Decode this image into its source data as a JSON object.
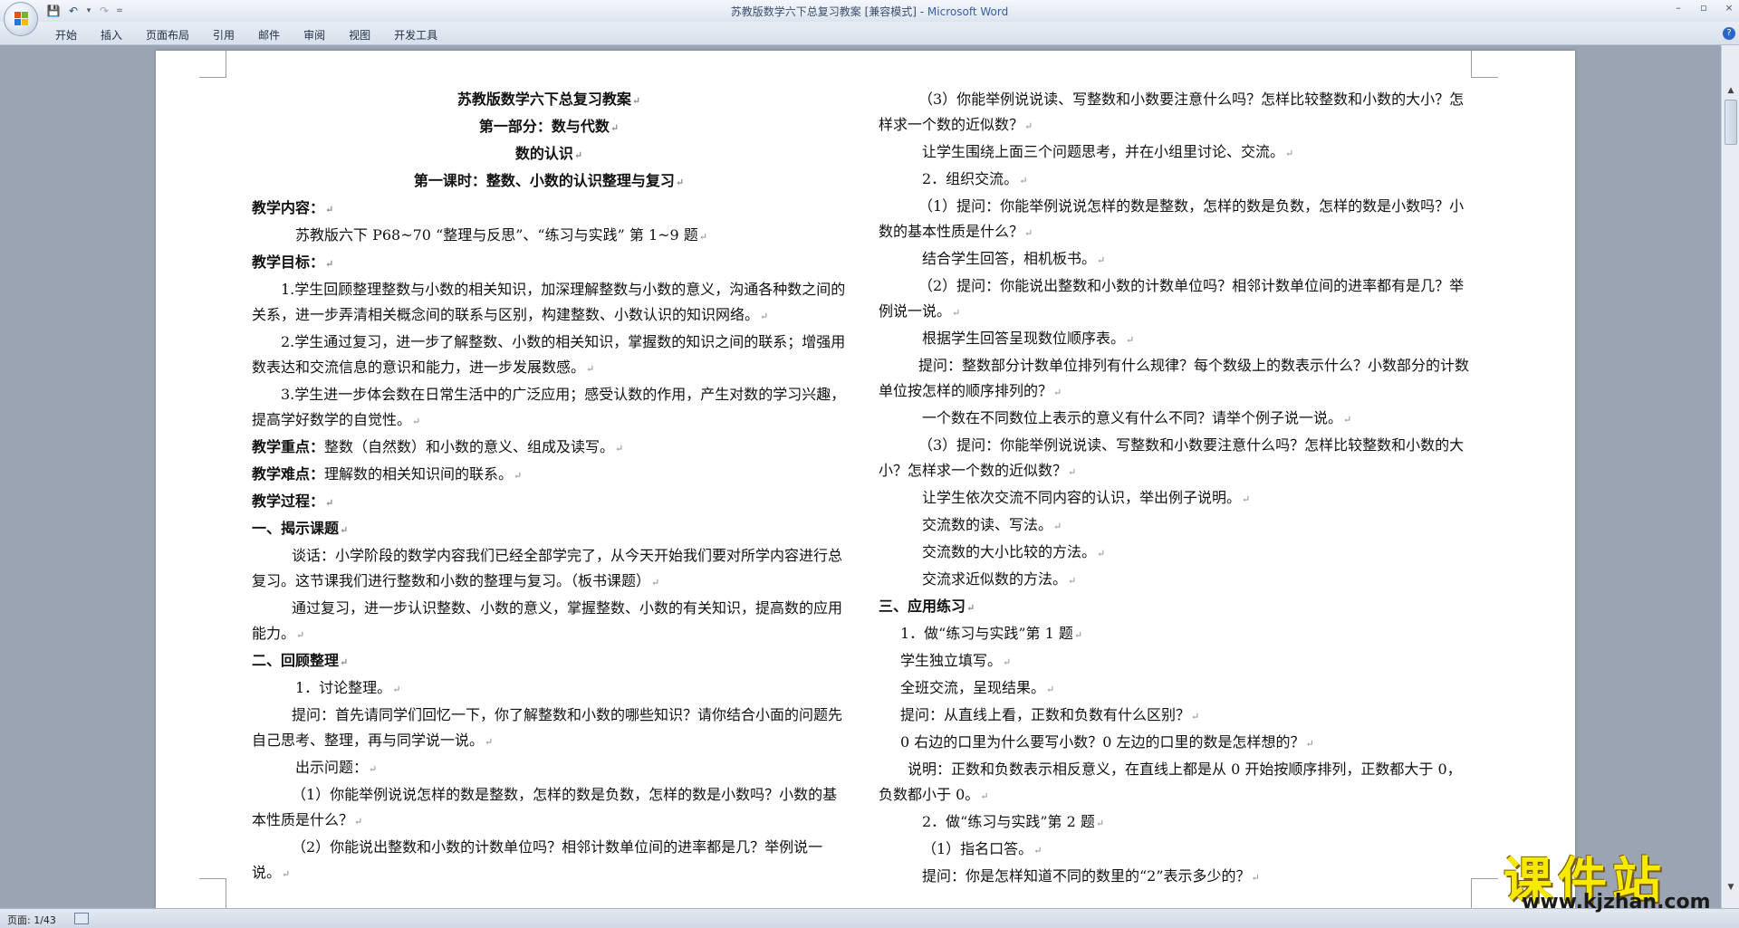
{
  "window": {
    "title": "苏教版数学六下总复习教案 [兼容模式] - ",
    "app_name": "Microsoft Word",
    "controls": [
      "–",
      "▫",
      "×"
    ]
  },
  "qat": {
    "save_icon": "💾",
    "undo_icon": "↶",
    "redo_icon": "↷",
    "dropdown": "▾",
    "customize": "="
  },
  "ribbon": {
    "tabs": [
      "开始",
      "插入",
      "页面布局",
      "引用",
      "邮件",
      "审阅",
      "视图",
      "开发工具"
    ],
    "help_icon": "?"
  },
  "document": {
    "left": [
      {
        "text": "苏教版数学六下总复习教案",
        "style": "center b"
      },
      {
        "text": "第一部分：数与代数",
        "style": "center b"
      },
      {
        "text": "数的认识",
        "style": "center b"
      },
      {
        "text": "第一课时：整数、小数的认识整理与复习",
        "style": "center b"
      },
      {
        "text": "教学内容：",
        "style": "b"
      },
      {
        "text": "苏教版六下 P68~70 “整理与反思”、“练习与实践” 第 1~9 题",
        "style": "ind3"
      },
      {
        "text": "教学目标：",
        "style": "b"
      },
      {
        "text": "1.学生回顾整理整数与小数的相关知识，加深理解整数与小数的意义，沟通各种数之间的关系，进一步弄清相关概念间的联系与区别，构建整数、小数认识的知识网络。",
        "style": "i1"
      },
      {
        "text": "2.学生通过复习，进一步了解整数、小数的相关知识，掌握数的知识之间的联系；增强用数表达和交流信息的意识和能力，进一步发展数感。",
        "style": "i1"
      },
      {
        "text": "3.学生进一步体会数在日常生活中的广泛应用；感受认数的作用，产生对数的学习兴趣，提高学好数学的自觉性。",
        "style": "i1"
      },
      {
        "text": "教学重点：整数（自然数）和小数的意义、组成及读写。",
        "style": "b-lead",
        "lead": "教学重点：",
        "rest": "整数（自然数）和小数的意义、组成及读写。"
      },
      {
        "text": "教学难点：理解数的相关知识间的联系。",
        "style": "b-lead",
        "lead": "教学难点：",
        "rest": "理解数的相关知识间的联系。"
      },
      {
        "text": "教学过程：",
        "style": "b"
      },
      {
        "text": "一、揭示课题",
        "style": "b"
      },
      {
        "text": "谈话：小学阶段的数学内容我们已经全部学完了，从今天开始我们要对所学内容进行总复习。这节课我们进行整数和小数的整理与复习。（板书课题）",
        "style": "i2"
      },
      {
        "text": "通过复习，进一步认识整数、小数的意义，掌握整数、小数的有关知识，提高数的应用能力。",
        "style": "i2"
      },
      {
        "text": "二、回顾整理",
        "style": "b"
      },
      {
        "text": "1．讨论整理。",
        "style": "ind3"
      },
      {
        "text": "提问：首先请同学们回忆一下，你了解整数和小数的哪些知识？请你结合小面的问题先自己思考、整理，再与同学说一说。",
        "style": "i2"
      },
      {
        "text": "出示问题：",
        "style": "ind3"
      },
      {
        "text": "（1）你能举例说说怎样的数是整数，怎样的数是负数，怎样的数是小数吗？小数的基本性质是什么？",
        "style": "i2"
      },
      {
        "text": "（2）你能说出整数和小数的计数单位吗？相邻计数单位间的进率都是几？举例说一说。",
        "style": "i2"
      }
    ],
    "right": [
      {
        "text": "（3）你能举例说说读、写整数和小数要注意什么吗？怎样比较整数和小数的大小？怎样求一个数的近似数？",
        "style": "i2"
      },
      {
        "text": "让学生围绕上面三个问题思考，并在小组里讨论、交流。",
        "style": "ind3"
      },
      {
        "text": "2．组织交流。",
        "style": "ind3"
      },
      {
        "text": "（1）提问：你能举例说说怎样的数是整数，怎样的数是负数，怎样的数是小数吗？小数的基本性质是什么？",
        "style": "i2"
      },
      {
        "text": "结合学生回答，相机板书。",
        "style": "ind3"
      },
      {
        "text": "（2）提问：你能说出整数和小数的计数单位吗？相邻计数单位间的进率都有是几？举例说一说。",
        "style": "i2"
      },
      {
        "text": "根据学生回答呈现数位顺序表。",
        "style": "ind3"
      },
      {
        "text": "提问：整数部分计数单位排列有什么规律？每个数级上的数表示什么？小数部分的计数单位按怎样的顺序排列的？",
        "style": "i2"
      },
      {
        "text": "一个数在不同数位上表示的意义有什么不同？请举个例子说一说。",
        "style": "ind3"
      },
      {
        "text": "（3）提问：你能举例说说读、写整数和小数要注意什么吗？怎样比较整数和小数的大小？怎样求一个数的近似数？",
        "style": "i2"
      },
      {
        "text": "让学生依次交流不同内容的认识，举出例子说明。",
        "style": "ind3"
      },
      {
        "text": "交流数的读、写法。",
        "style": "ind3"
      },
      {
        "text": "交流数的大小比较的方法。",
        "style": "ind3"
      },
      {
        "text": "交流求近似数的方法。",
        "style": "ind3"
      },
      {
        "text": "三、应用练习",
        "style": "b"
      },
      {
        "text": "1．做“练习与实践”第 1 题",
        "style": "ind"
      },
      {
        "text": "学生独立填写。",
        "style": "ind"
      },
      {
        "text": "全班交流，呈现结果。",
        "style": "ind"
      },
      {
        "text": "提问：从直线上看，正数和负数有什么区别？",
        "style": "ind"
      },
      {
        "text": "0 右边的口里为什么要写小数？0 左边的口里的数是怎样想的？",
        "style": "ind"
      },
      {
        "text": "说明：正数和负数表示相反意义，在直线上都是从 0 开始按顺序排列，正数都大于 0，负数都小于 0。",
        "style": "i1"
      },
      {
        "text": "2．做“练习与实践”第 2 题",
        "style": "ind3"
      },
      {
        "text": "（1）指名口答。",
        "style": "ind3"
      },
      {
        "text": "提问：你是怎样知道不同的数里的“2”表示多少的？",
        "style": "ind3"
      }
    ],
    "para_mark": "↵"
  },
  "status": {
    "page": "页面: 1/43"
  },
  "watermark": {
    "text": "课件站",
    "url": "www.kjzhan.com"
  }
}
